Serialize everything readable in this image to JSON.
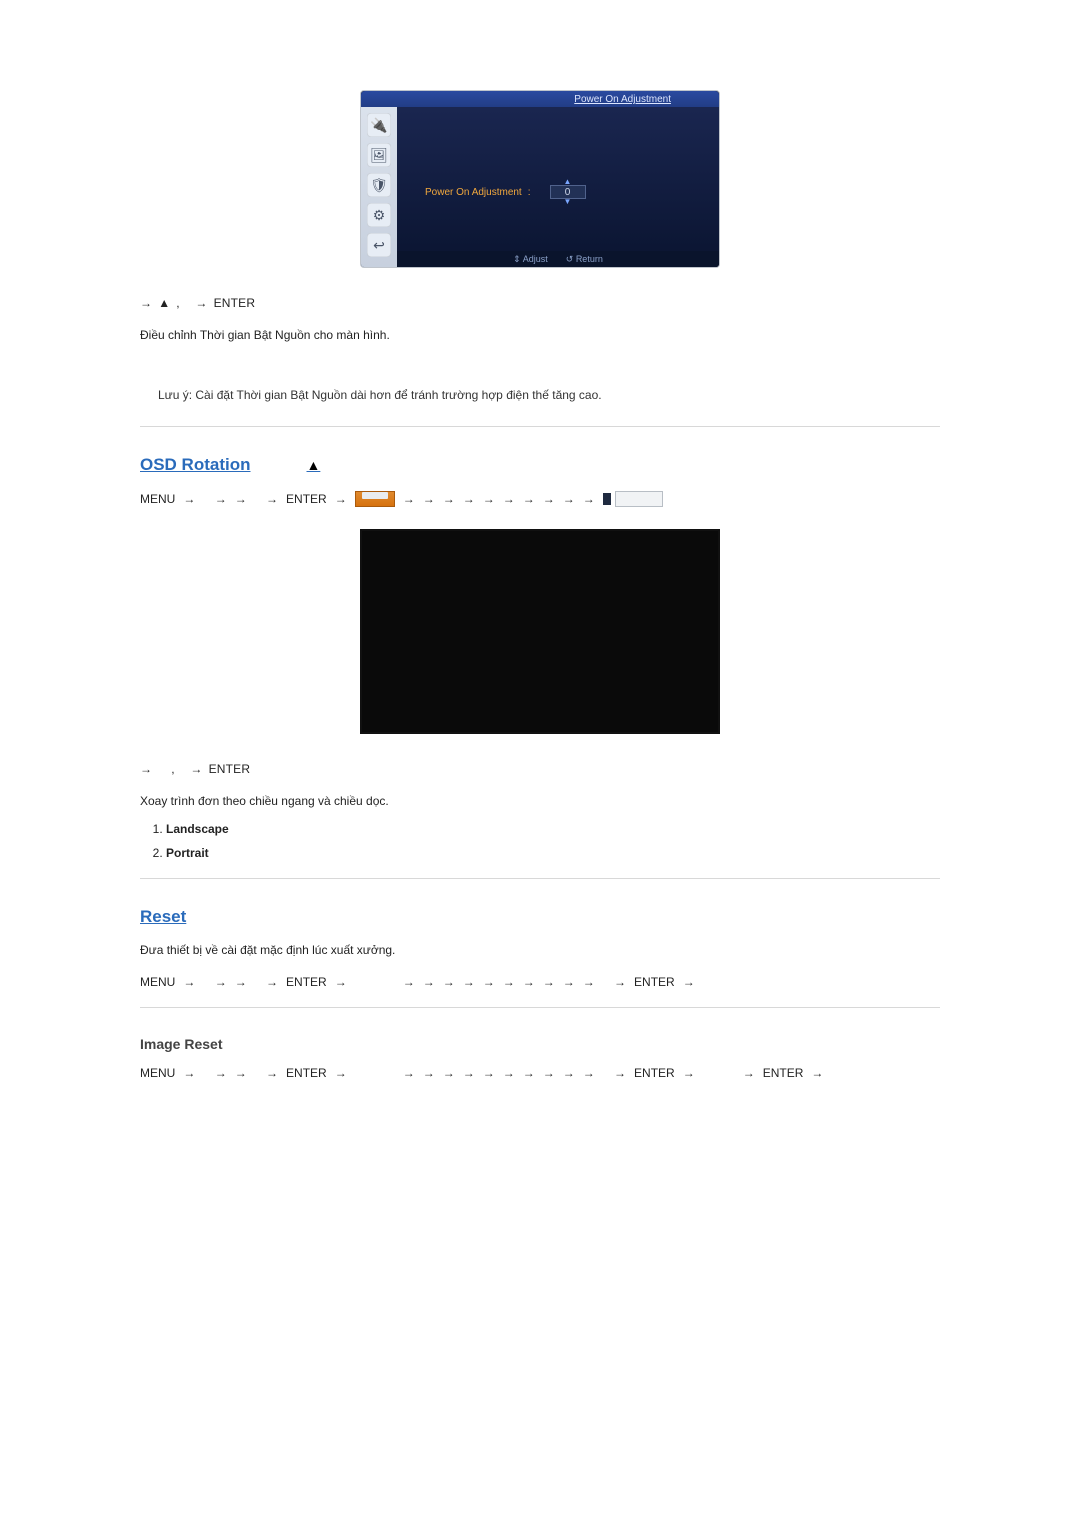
{
  "osd_power": {
    "title": "Power On Adjustment",
    "row_label": "Power On Adjustment",
    "separator": ":",
    "value": "0",
    "footer_adjust": "Adjust",
    "footer_return": "Return",
    "rail_icons": [
      "power-icon",
      "picture-icon",
      "shield-icon",
      "gear-icon",
      "exit-icon"
    ]
  },
  "nav1": {
    "arrow": "→",
    "up": "▲",
    "comma": ",",
    "enter": "ENTER"
  },
  "power_desc": "Điều chỉnh Thời gian Bật Nguồn cho màn hình.",
  "power_note_label": "Lưu ý",
  "power_note_text": ": Cài đặt Thời gian Bật Nguồn dài hơn để tránh trường hợp điện thế tăng cao.",
  "osd_rotation": {
    "title": "OSD Rotation",
    "menu": "MENU",
    "enter": "ENTER",
    "arrow": "→"
  },
  "rotation_nav": {
    "arrow": "→",
    "comma": ",",
    "enter": "ENTER"
  },
  "rotation_desc": "Xoay trình đơn theo chiều ngang và chiều dọc.",
  "rotation_options": [
    "Landscape",
    "Portrait"
  ],
  "reset": {
    "title": "Reset",
    "desc": "Đưa thiết bị về cài đặt mặc định lúc xuất xưởng.",
    "menu": "MENU",
    "enter": "ENTER",
    "arrow": "→"
  },
  "image_reset": {
    "title": "Image Reset",
    "menu": "MENU",
    "enter": "ENTER",
    "arrow": "→"
  },
  "glyphs": {
    "updown": "⇕",
    "return": "↺",
    "top": "▲"
  }
}
